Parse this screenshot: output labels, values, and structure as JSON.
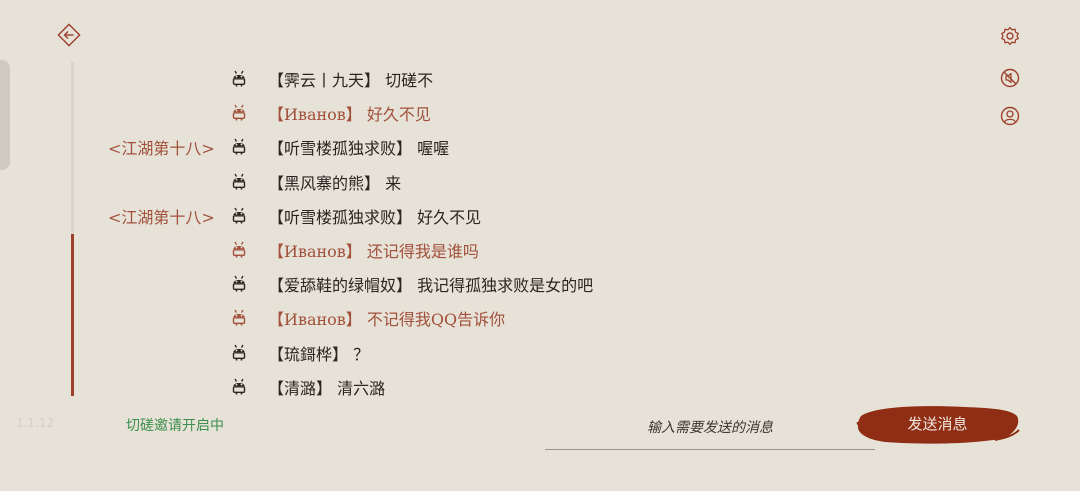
{
  "version": "1.1.12",
  "status_text": "切磋邀请开启中",
  "input": {
    "placeholder": "输入需要发送的消息",
    "value": ""
  },
  "send_label": "发送消息",
  "colors": {
    "accent": "#9e3f2b",
    "background": "#e6e2d7",
    "status": "#3e8f4e",
    "own_message": "#a2503b"
  },
  "icons": {
    "back": "back-arrow-icon",
    "settings": "gear-icon",
    "mute": "no-sound-icon",
    "profile": "user-icon",
    "avatar": "android-robot-icon"
  },
  "scroll_position": 0.52,
  "messages": [
    {
      "tag": "",
      "sender": "【霁云丨九天】",
      "text": "切磋不",
      "own": false
    },
    {
      "tag": "",
      "sender": "【Иванов】",
      "text": "好久不见",
      "own": true
    },
    {
      "tag": "<江湖第十八>",
      "sender": "【听雪楼孤独求败】",
      "text": "喔喔",
      "own": false
    },
    {
      "tag": "",
      "sender": "【黑风寨的熊】",
      "text": "来",
      "own": false
    },
    {
      "tag": "<江湖第十八>",
      "sender": "【听雪楼孤独求败】",
      "text": "好久不见",
      "own": false
    },
    {
      "tag": "",
      "sender": "【Иванов】",
      "text": "还记得我是谁吗",
      "own": true
    },
    {
      "tag": "",
      "sender": "【爱舔鞋的绿帽奴】",
      "text": "我记得孤独求败是女的吧",
      "own": false
    },
    {
      "tag": "",
      "sender": "【Иванов】",
      "text": "不记得我QQ告诉你",
      "own": true
    },
    {
      "tag": "",
      "sender": "【琉鎶桦】",
      "text": "？",
      "own": false
    },
    {
      "tag": "",
      "sender": "【清潞】",
      "text": "清六潞",
      "own": false
    }
  ]
}
